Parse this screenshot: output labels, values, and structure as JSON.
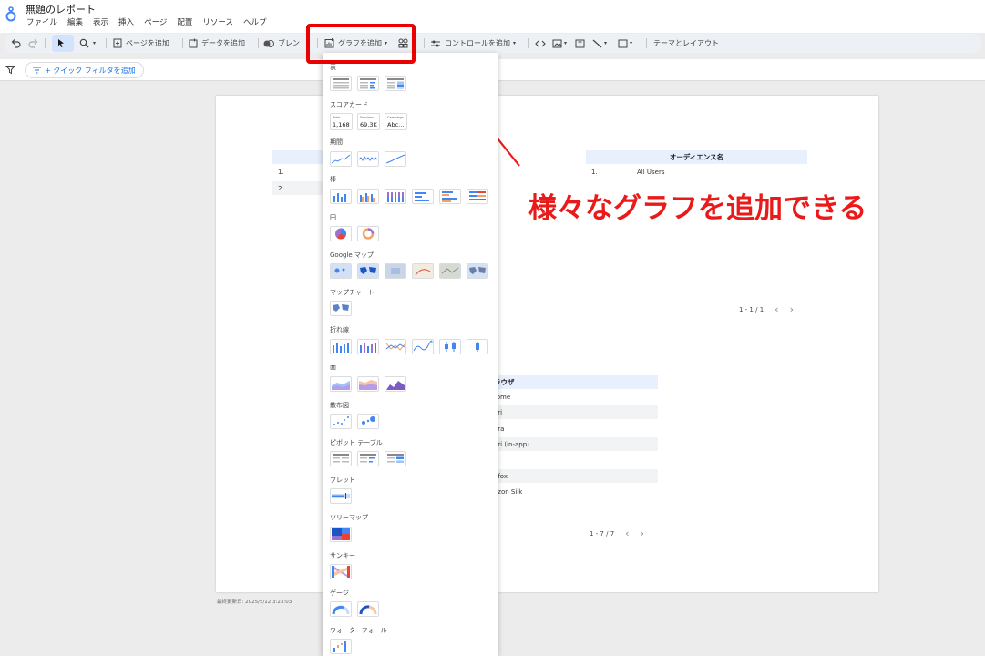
{
  "app": {
    "doc_title": "無題のレポート",
    "menu": [
      "ファイル",
      "編集",
      "表示",
      "挿入",
      "ページ",
      "配置",
      "リソース",
      "ヘルプ"
    ]
  },
  "toolbar": {
    "add_page": "ページを追加",
    "add_data": "データを追加",
    "blend": "ブレン",
    "add_chart": "グラフを追加",
    "add_control": "コントロールを追加",
    "theme_layout": "テーマとレイアウト"
  },
  "filterbar": {
    "quick_filter": "+ クイック フィルタを追加"
  },
  "canvas": {
    "table1": {
      "rows": [
        "1.",
        "2."
      ]
    },
    "table2": {
      "header": "オーディエンス名",
      "rows": [
        {
          "idx": "1.",
          "name": "All Users"
        }
      ],
      "pager": "1 - 1 / 1"
    },
    "table3": {
      "header": "ラウザ",
      "rows": [
        "rome",
        "ari",
        "era",
        "ari (in-app)",
        "e",
        "efox",
        "azon Silk"
      ],
      "pager": "1 - 7 / 7"
    },
    "last_updated": "最終更新日: 2025/5/12 3:23:03"
  },
  "dropdown": {
    "sections": {
      "table": "表",
      "scorecard": "スコアカード",
      "timeseries": "期間",
      "bar": "棒",
      "pie": "円",
      "google_maps": "Google マップ",
      "map_chart": "マップチャート",
      "line": "折れ線",
      "area": "面",
      "scatter": "散布図",
      "pivot": "ピボット テーブル",
      "bullet": "ブレット",
      "treemap": "ツリーマップ",
      "sankey": "サンキー",
      "gauge": "ゲージ",
      "waterfall": "ウォーターフォール"
    },
    "scorecards": [
      {
        "label": "Total",
        "value": "1,168"
      },
      {
        "label": "Sessions",
        "value": "69.3K"
      },
      {
        "label": "Campaign",
        "value": "Abc..."
      }
    ]
  },
  "annotation": {
    "text": "様々なグラフを追加できる",
    "color": "#ea1a1a"
  },
  "colors": {
    "accent": "#1a73e8",
    "highlight": "#ea0000",
    "toolbar_bg": "#edf0f5"
  }
}
